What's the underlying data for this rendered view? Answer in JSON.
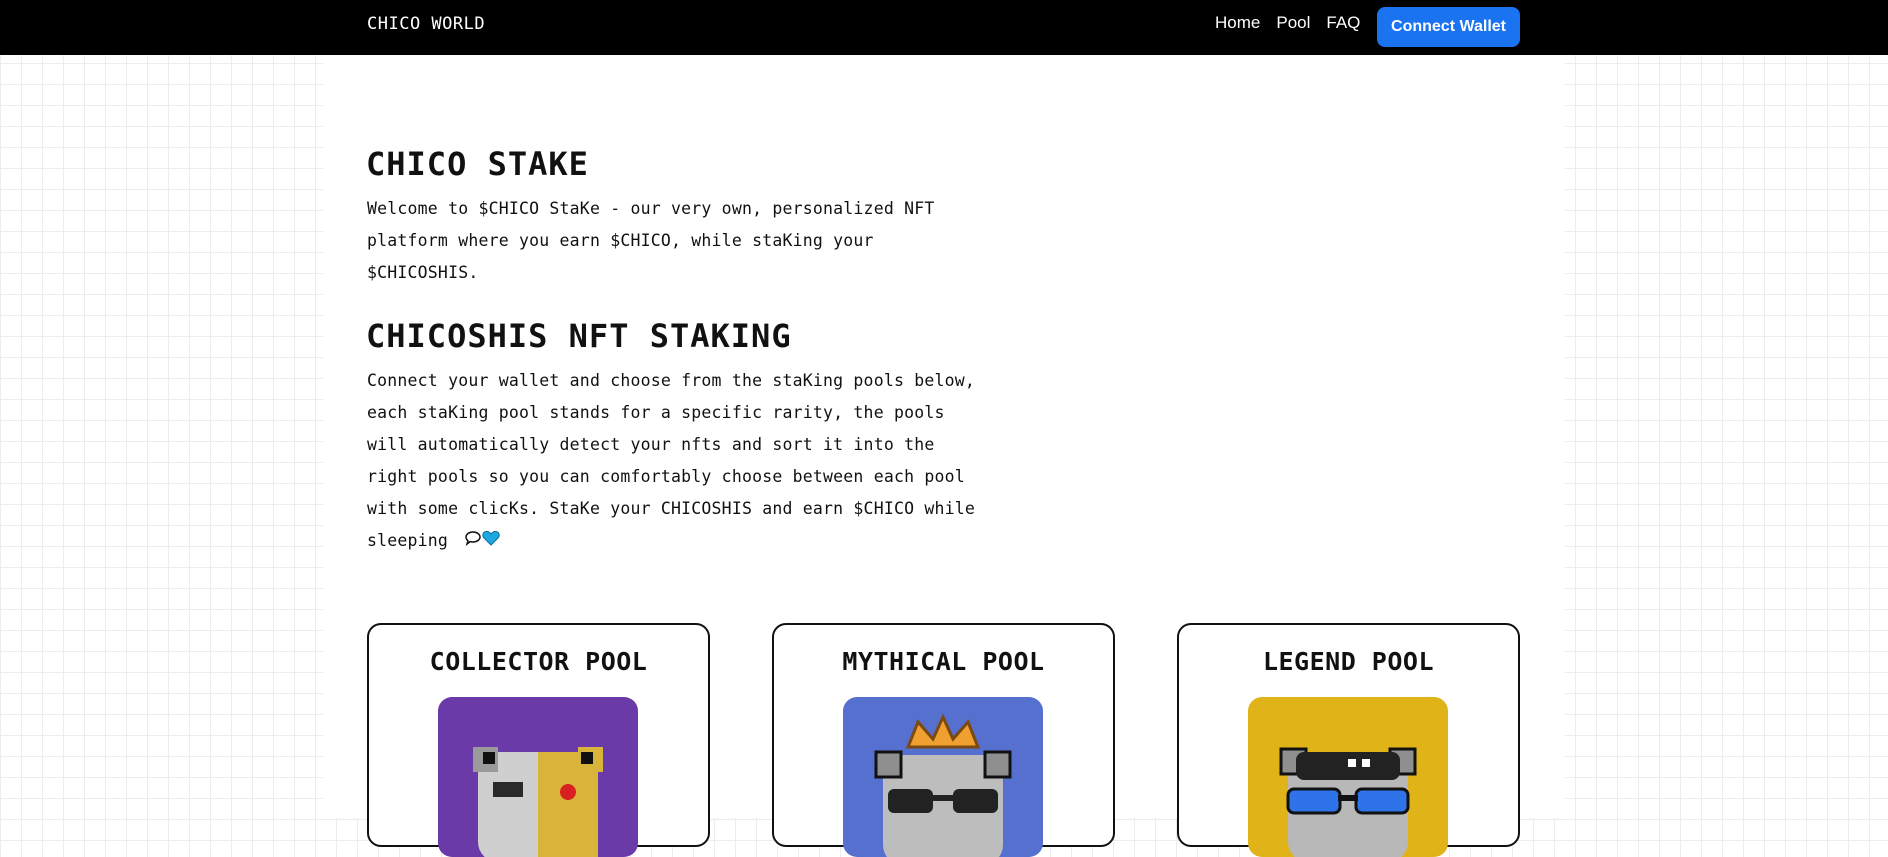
{
  "header": {
    "brand": "CHICO WORLD",
    "nav": [
      "Home",
      "Pool",
      "FAQ"
    ],
    "connect_label": "Connect Wallet"
  },
  "intro": {
    "title": "CHICO STAKE",
    "text": "Welcome to $CHICO StaKe - our very own, personalized NFT platform where you earn $CHICO, while staKing your $CHICOSHIS."
  },
  "staking": {
    "title": "CHICOSHIS NFT STAKING",
    "text": "Connect your wallet and choose from the staKing pools below, each staKing pool stands for a specific rarity, the pools will automatically detect your nfts and sort it into the right pools so you can comfortably choose between each pool with some clicKs. StaKe your CHICOSHIS and earn $CHICO while sleeping"
  },
  "pools": [
    {
      "title": "COLLECTOR POOL",
      "bg": "#6a3aa8"
    },
    {
      "title": "MYTHICAL POOL",
      "bg": "#5670d0"
    },
    {
      "title": "LEGEND POOL",
      "bg": "#e0b418"
    }
  ],
  "colors": {
    "accent": "#1a73f0",
    "heart": "#1ca7e0"
  },
  "icons": {
    "speech": "speech-bubble-icon",
    "heart": "blue-heart-icon"
  }
}
